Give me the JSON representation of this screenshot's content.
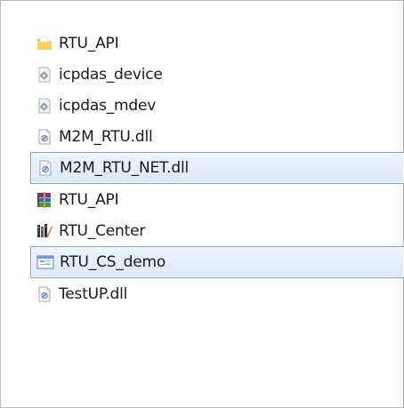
{
  "files": [
    {
      "name": "RTU_API",
      "icon": "folder-icon",
      "selected": false
    },
    {
      "name": "icpdas_device",
      "icon": "settings-file-icon",
      "selected": false
    },
    {
      "name": "icpdas_mdev",
      "icon": "settings-file-icon",
      "selected": false
    },
    {
      "name": "M2M_RTU.dll",
      "icon": "dll-file-icon",
      "selected": false
    },
    {
      "name": "M2M_RTU_NET.dll",
      "icon": "dll-file-icon",
      "selected": true
    },
    {
      "name": "RTU_API",
      "icon": "winrar-archive-icon",
      "selected": false
    },
    {
      "name": "RTU_Center",
      "icon": "rtu-center-app-icon",
      "selected": false
    },
    {
      "name": "RTU_CS_demo",
      "icon": "application-window-icon",
      "selected": true
    },
    {
      "name": "TestUP.dll",
      "icon": "dll-file-icon",
      "selected": false
    }
  ],
  "colors": {
    "selection_border": "#7da2ce",
    "selection_fill": "#dbe8fa",
    "folder": "#f2c45a"
  }
}
